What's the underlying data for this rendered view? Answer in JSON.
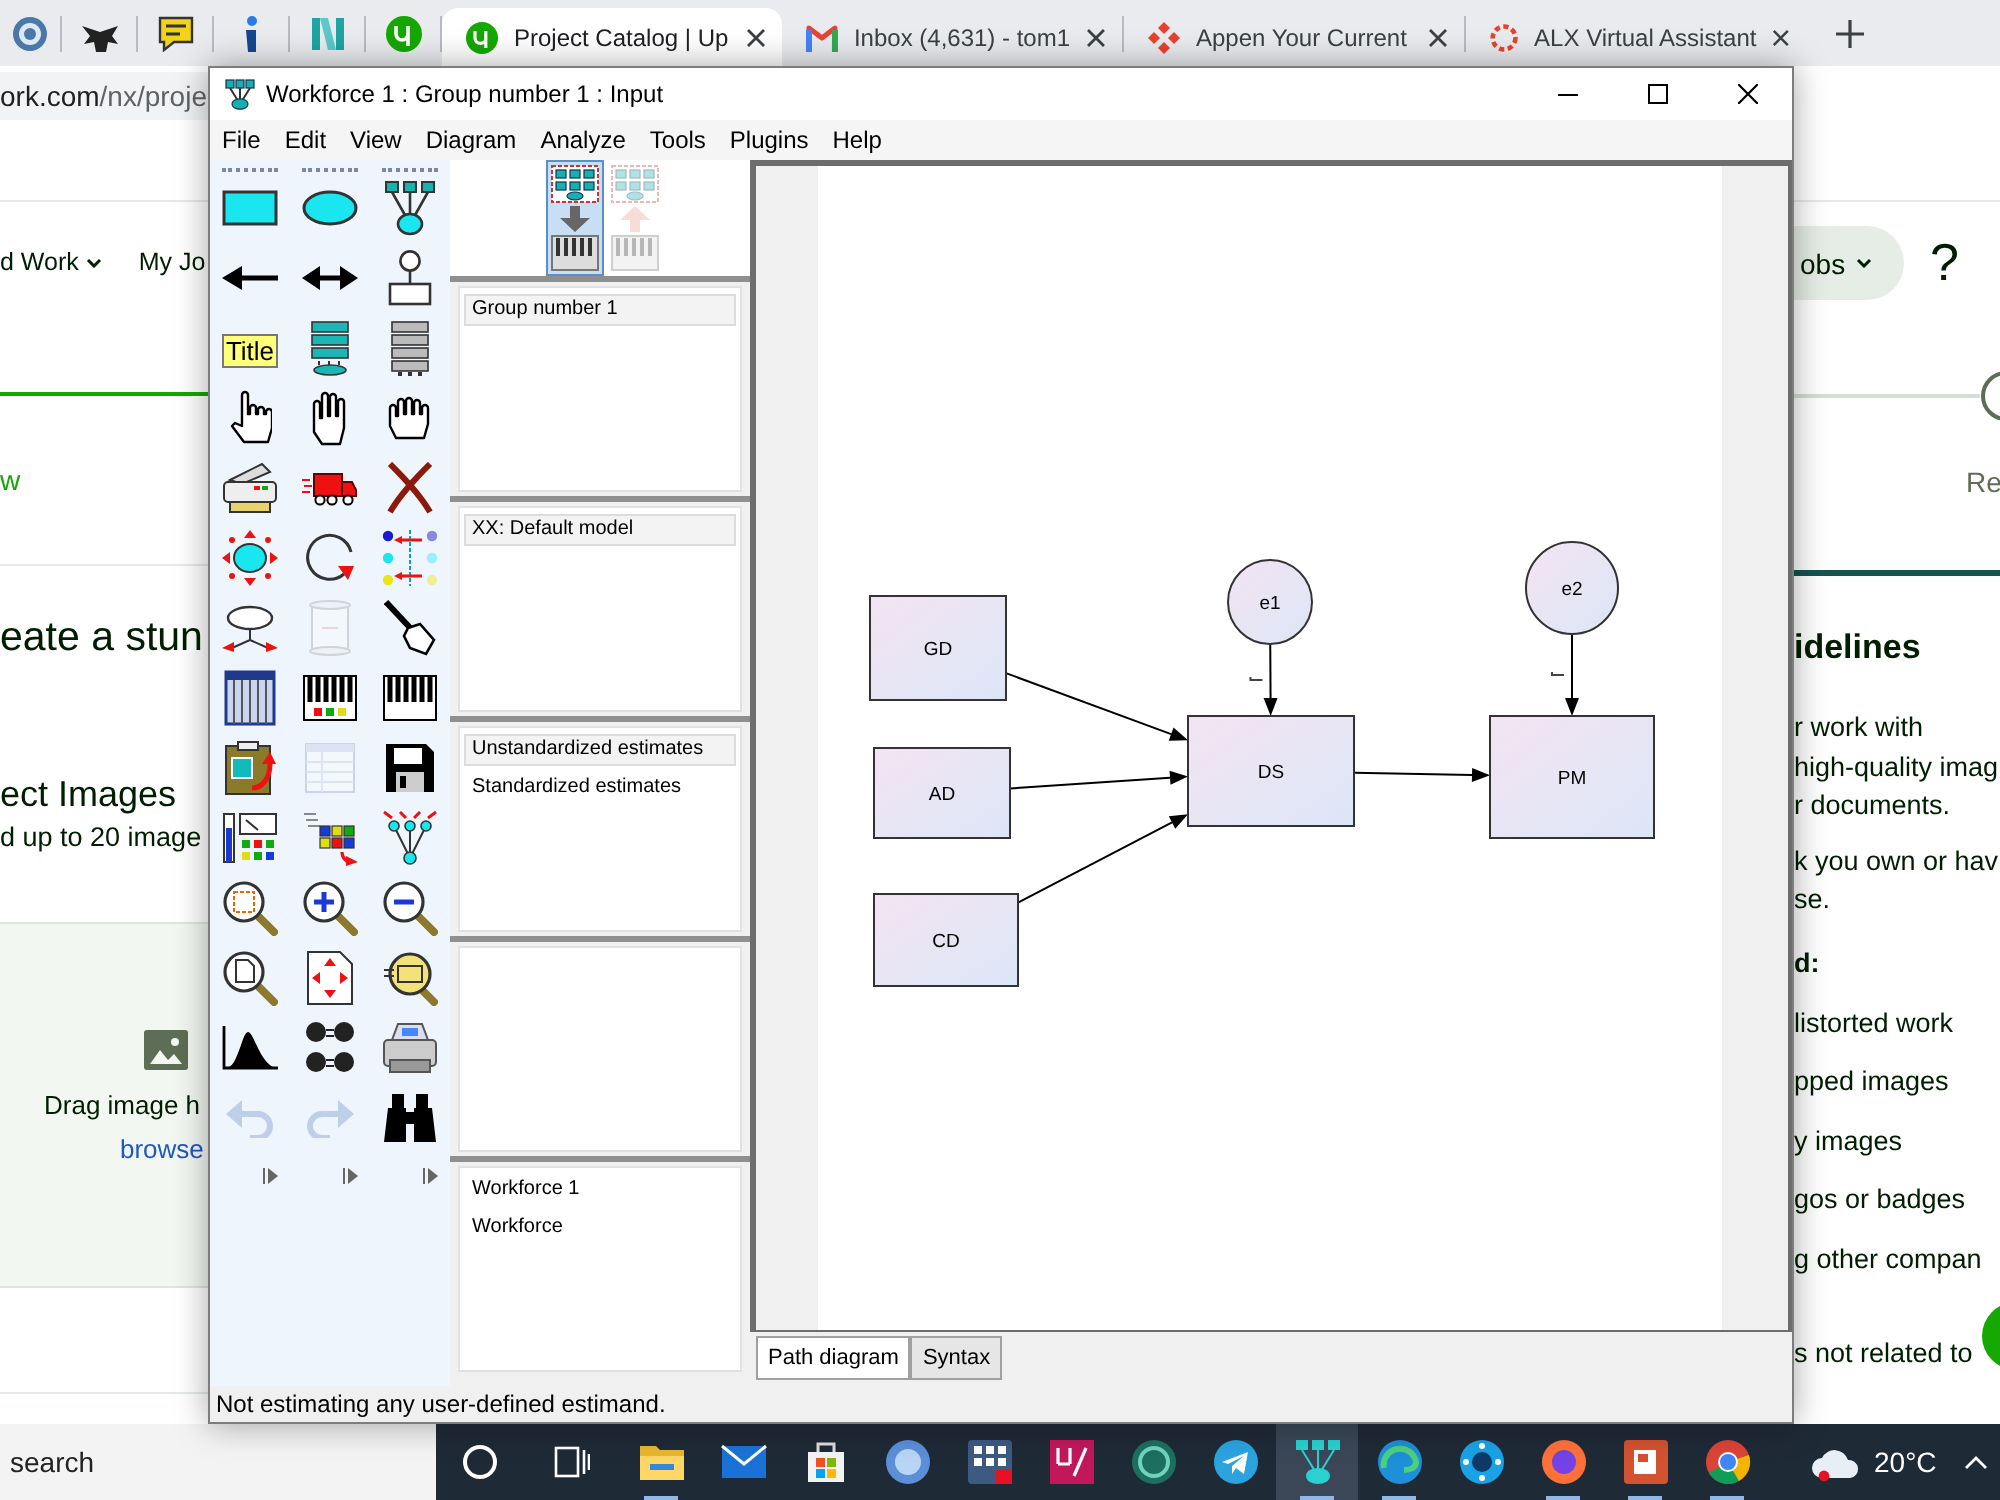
{
  "browser": {
    "tabs": [
      {
        "title": "Project Catalog | Up",
        "selected": true
      },
      {
        "title": "Inbox (4,631) - tom1",
        "selected": false
      },
      {
        "title": "Appen Your Current",
        "selected": false
      },
      {
        "title": "ALX Virtual Assistant",
        "selected": false
      }
    ],
    "address": {
      "host": "ork.com",
      "path": "/nx/proje"
    }
  },
  "web_page": {
    "left": {
      "nav": [
        {
          "label": "d Work",
          "dropdown": true
        },
        {
          "label": "My Jo",
          "dropdown": false
        }
      ],
      "step": "w",
      "heading": "eate a stun",
      "section_title": "ect Images",
      "section_hint": "d up to 20 image",
      "dropzone_text": "Drag image h",
      "dropzone_link": "browse"
    },
    "right": {
      "nav_button": {
        "label": "obs",
        "dropdown": true
      },
      "help": "?",
      "step": "Re",
      "heading": "idelines",
      "paragraphs": [
        [
          "r work with",
          "high-quality imag",
          "r documents."
        ],
        [
          "k you own or hav",
          "se."
        ]
      ],
      "list_title": "d:",
      "list": [
        "listorted work",
        "pped images",
        "y images",
        "gos or badges",
        "g other compan",
        "s not related to"
      ]
    }
  },
  "app_window": {
    "title": "Workforce 1 : Group number 1 : Input",
    "menu": [
      "File",
      "Edit",
      "View",
      "Diagram",
      "Analyze",
      "Tools",
      "Plugins",
      "Help"
    ],
    "tools": [
      {
        "disabled": false
      },
      {
        "disabled": false
      },
      {
        "disabled": false
      },
      {
        "disabled": false
      },
      {
        "disabled": false
      },
      {
        "disabled": false
      },
      {
        "label": "Title",
        "disabled": false
      },
      {
        "disabled": false
      },
      {
        "disabled": false
      },
      {
        "disabled": false
      },
      {
        "disabled": false
      },
      {
        "disabled": false
      },
      {
        "disabled": false
      },
      {
        "disabled": false
      },
      {
        "disabled": false
      },
      {
        "disabled": false
      },
      {
        "disabled": false
      },
      {
        "disabled": false
      },
      {
        "disabled": false
      },
      {
        "disabled": true
      },
      {
        "disabled": false
      },
      {
        "disabled": false
      },
      {
        "disabled": false
      },
      {
        "disabled": false
      },
      {
        "disabled": false
      },
      {
        "disabled": true
      },
      {
        "disabled": false
      },
      {
        "disabled": false
      },
      {
        "disabled": false
      },
      {
        "disabled": false
      },
      {
        "disabled": false
      },
      {
        "disabled": false
      },
      {
        "disabled": false
      },
      {
        "disabled": false
      },
      {
        "disabled": false
      },
      {
        "disabled": false
      },
      {
        "disabled": false
      },
      {
        "disabled": false
      },
      {
        "disabled": false
      },
      {
        "disabled": true
      },
      {
        "disabled": true
      },
      {
        "disabled": false
      }
    ],
    "view_buttons": [
      {
        "selected": true,
        "disabled": false
      },
      {
        "selected": false,
        "disabled": true
      }
    ],
    "panels": {
      "panel_1": [
        {
          "label": "Group number 1",
          "selected": true
        }
      ],
      "panel_2": [
        {
          "label": "XX: Default model",
          "selected": true
        }
      ],
      "panel_3": [
        {
          "label": "Unstandardized estimates",
          "selected": true
        },
        {
          "label": "Standardized estimates",
          "selected": false
        }
      ],
      "panel_5": [
        {
          "label": "Workforce 1",
          "selected": false
        },
        {
          "label": "Workforce",
          "selected": false
        }
      ]
    },
    "diagram": {
      "nodes": [
        {
          "label": "GD",
          "kind": "observed"
        },
        {
          "label": "AD",
          "kind": "observed"
        },
        {
          "label": "CD",
          "kind": "observed"
        },
        {
          "label": "DS",
          "kind": "observed"
        },
        {
          "label": "PM",
          "kind": "observed"
        },
        {
          "label": "e1",
          "kind": "unobserved"
        },
        {
          "label": "e2",
          "kind": "unobserved"
        }
      ]
    },
    "tabs": [
      {
        "label": "Path diagram",
        "selected": true
      },
      {
        "label": "Syntax",
        "selected": false
      }
    ],
    "status": "Not estimating any user-defined estimand."
  },
  "taskbar": {
    "search_placeholder": "search",
    "apps": [
      {
        "running": true,
        "active": false
      },
      {
        "running": false,
        "active": false
      },
      {
        "running": false,
        "active": false
      },
      {
        "running": false,
        "active": false
      },
      {
        "running": false,
        "active": false
      },
      {
        "running": false,
        "active": false
      },
      {
        "running": false,
        "active": false
      },
      {
        "running": false,
        "active": false
      },
      {
        "running": true,
        "active": true
      },
      {
        "running": true,
        "active": false
      },
      {
        "running": false,
        "active": false
      },
      {
        "running": true,
        "active": false
      },
      {
        "running": true,
        "active": false
      },
      {
        "running": true,
        "active": false
      }
    ],
    "temperature": "20°C"
  }
}
